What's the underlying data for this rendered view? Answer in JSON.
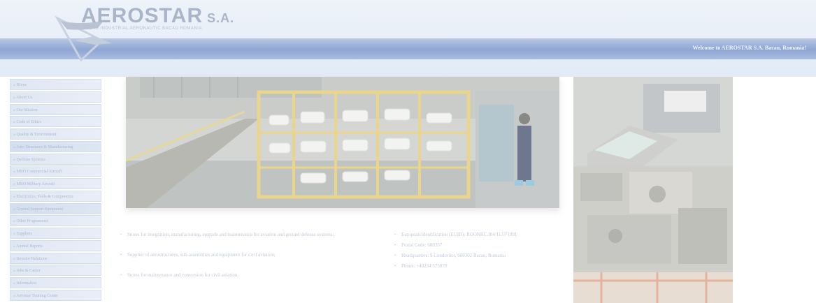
{
  "header": {
    "logo_name": "AEROSTAR",
    "logo_suffix": "S.A.",
    "logo_tagline": "BACAU INDUSTRIAL AERONAUTIC BACAU ROMANIA",
    "welcome": "Welcome to AEROSTAR S.A. Bacau, Romania!"
  },
  "sidebar": {
    "items": [
      {
        "label": "» Home"
      },
      {
        "label": "» About Us"
      },
      {
        "label": "» Our Mission"
      },
      {
        "label": "» Code of Ethics"
      },
      {
        "label": "» Quality & Environment"
      },
      {
        "label": "» Aero Structures & Manufacturing"
      },
      {
        "label": "» Defense Systems"
      },
      {
        "label": "» MRO Commercial Aircraft"
      },
      {
        "label": "» MRO Military Aircraft"
      },
      {
        "label": "» Electronics, Tools & Components"
      },
      {
        "label": "» Ground Support Equipment"
      },
      {
        "label": "» Other Programmes"
      },
      {
        "label": "» Suppliers"
      },
      {
        "label": "» Annual Reports"
      },
      {
        "label": "» Investor Relations"
      },
      {
        "label": "» Jobs & Career"
      },
      {
        "label": "» Information"
      },
      {
        "label": "» Aerostar Training Center"
      }
    ]
  },
  "main": {
    "left_bullets": [
      "Stores for integration, manufacturing, upgrade and maintenance for aviation and ground defense systems;",
      "Supplier of aerostructures, sub-assemblies and equipment for civil aviation;",
      "Stores for maintenance and conversion for civil aviation."
    ],
    "right_bullets": [
      "European Identification (EUID): ROONRC.J04/1137/1991",
      "Postal Code: 600357",
      "Headquarters: 9 Condorilor, 600302 Bacau, Romania",
      "Phone: +40234 575070"
    ]
  },
  "colors": {
    "band": "#8fa6d3",
    "logo": "#aab6c8",
    "nav_bg": "#dfe7f4"
  }
}
